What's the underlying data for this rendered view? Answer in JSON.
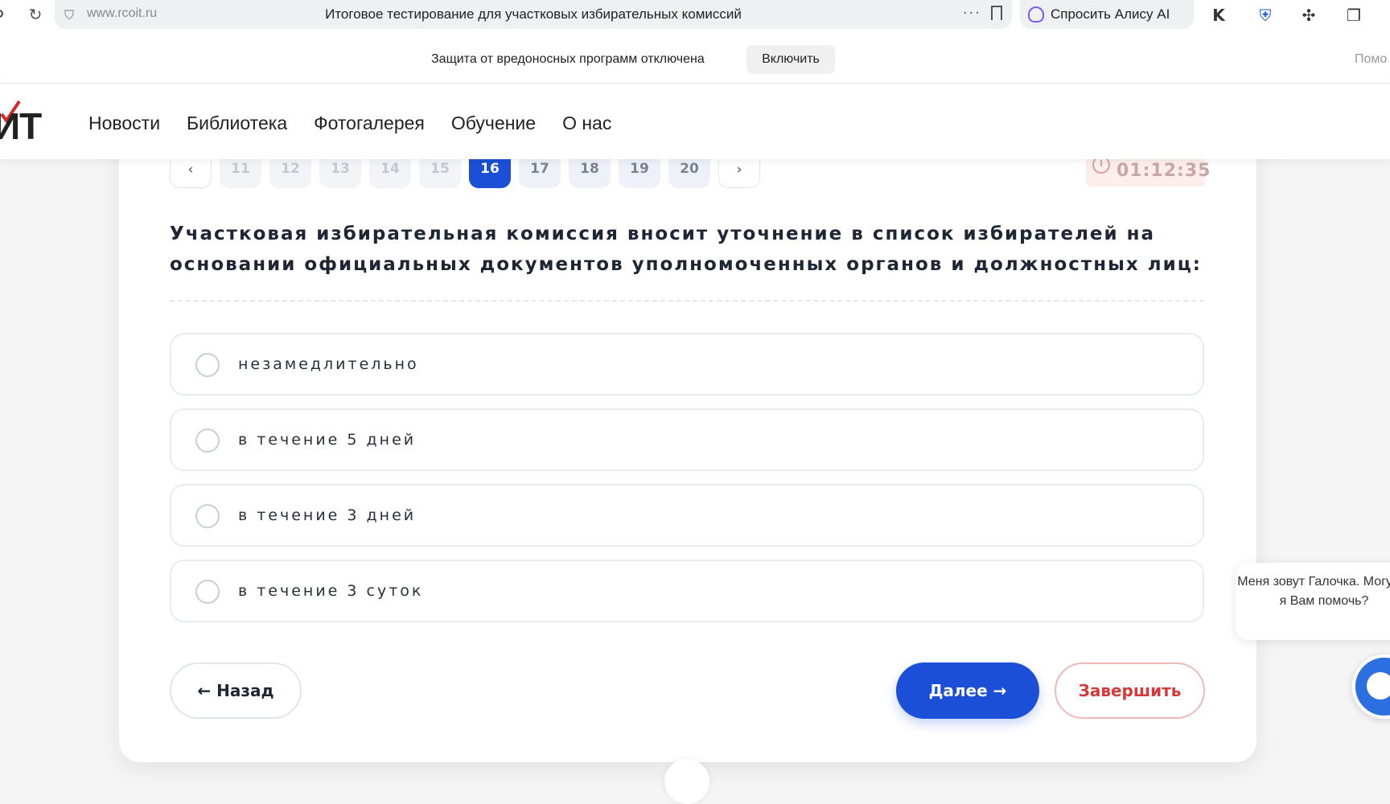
{
  "browser": {
    "url": "www.rcoit.ru",
    "tab_title": "Итоговое тестирование для участковых избирательных комиссий",
    "alice_label": "Спросить Алису AI"
  },
  "protection": {
    "message": "Защита от вредоносных программ отключена",
    "enable_label": "Включить",
    "help_label": "Помо"
  },
  "site": {
    "logo": "ИТ",
    "nav": [
      "Новости",
      "Библиотека",
      "Фотогалерея",
      "Обучение",
      "О нас"
    ]
  },
  "pager": {
    "prev": "‹",
    "next": "›",
    "pages": [
      "11",
      "12",
      "13",
      "14",
      "15",
      "16",
      "17",
      "18",
      "19",
      "20"
    ],
    "current": "16"
  },
  "timer": "01:12:35",
  "question": "Участковая избирательная комиссия вносит уточнение в список избирателей на основании официальных документов уполномоченных органов и должностных лиц:",
  "options": [
    "незамедлительно",
    "в течение 5 дней",
    "в течение 3 дней",
    "в течение 3 суток"
  ],
  "buttons": {
    "back": "← Назад",
    "next": "Далее →",
    "finish": "Завершить"
  },
  "chat": {
    "bubble": "Меня зовут Галочка. Могу ли я Вам помочь?"
  },
  "colors": {
    "accent": "#1b4fd8",
    "finish": "#d43a3a"
  }
}
